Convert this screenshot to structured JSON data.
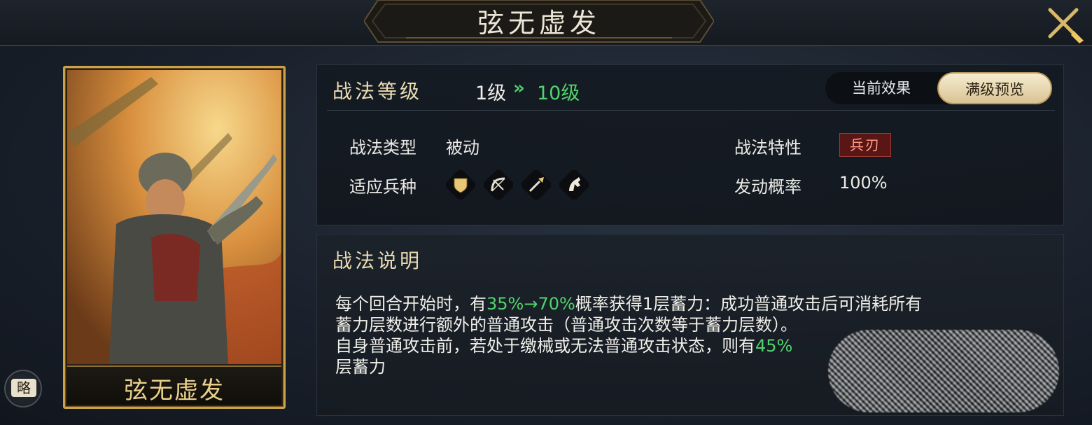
{
  "header": {
    "title": "弦无虚发"
  },
  "card": {
    "name": "弦无虚发",
    "strategy_button_label": "略"
  },
  "level": {
    "section_title": "战法等级",
    "from": "1级",
    "arrow": "»",
    "to": "10级",
    "toggle": {
      "current_label": "当前效果",
      "full_label": "满级预览",
      "selected": "满级预览"
    }
  },
  "attributes": {
    "type_label": "战法类型",
    "type_value": "被动",
    "troops_label": "适应兵种",
    "troops": [
      "shield-icon",
      "bow-icon",
      "spear-icon",
      "horse-icon"
    ],
    "trait_label": "战法特性",
    "trait_value": "兵刃",
    "rate_label": "发动概率",
    "rate_value": "100%"
  },
  "description": {
    "section_title": "战法说明",
    "line1_a": "每个回合开始时，有",
    "line1_green": "35%→70%",
    "line1_b": "概率获得1层蓄力：成功普通攻击后可消耗所有",
    "line2": "蓄力层数进行额外的普通攻击（普通攻击次数等于蓄力层数）。",
    "line3_a": "自身普通攻击前，若处于缴械或无法普通攻击状态，则有",
    "line3_green": "45%",
    "line4": "层蓄力"
  },
  "colors": {
    "accent_green": "#4fd46c",
    "gold": "#c9a24a",
    "trait_red": "#5a1614"
  }
}
